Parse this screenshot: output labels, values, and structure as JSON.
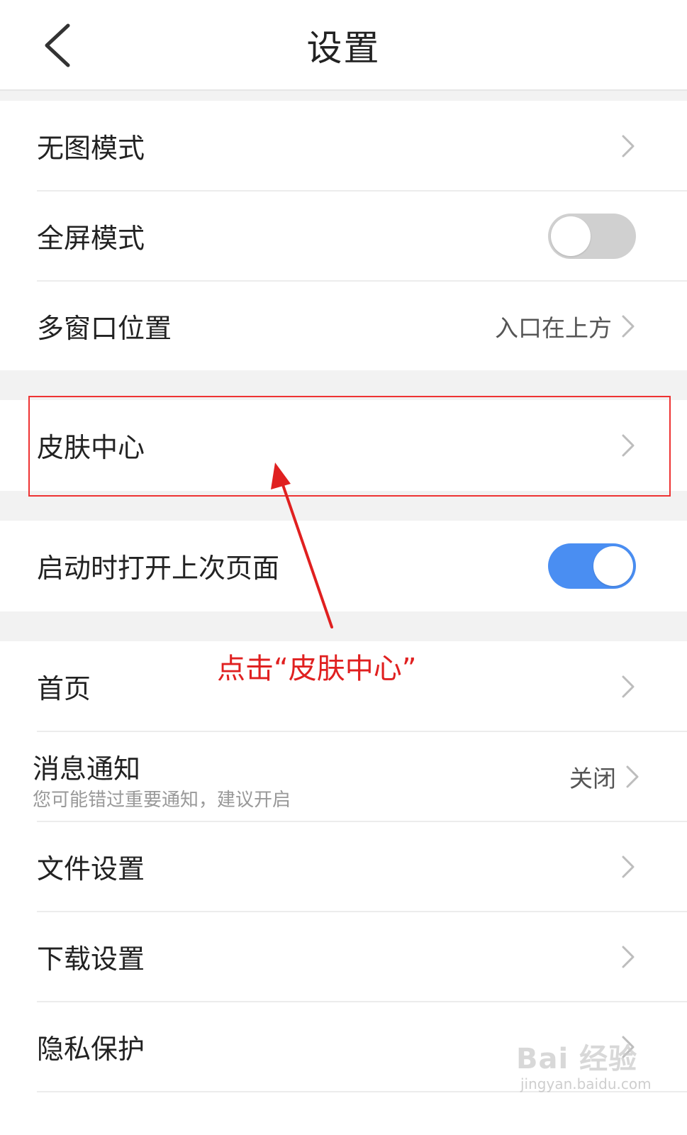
{
  "header": {
    "title": "设置"
  },
  "rows": {
    "no_image": {
      "label": "无图模式"
    },
    "fullscreen": {
      "label": "全屏模式",
      "enabled": false
    },
    "multi_window": {
      "label": "多窗口位置",
      "value": "入口在上方"
    },
    "skin_center": {
      "label": "皮肤中心"
    },
    "restore_last": {
      "label": "启动时打开上次页面",
      "enabled": true
    },
    "homepage": {
      "label": "首页"
    },
    "notification": {
      "label": "消息通知",
      "sublabel": "您可能错过重要通知，建议开启",
      "value": "关闭"
    },
    "file_settings": {
      "label": "文件设置"
    },
    "download_settings": {
      "label": "下载设置"
    },
    "privacy": {
      "label": "隐私保护"
    }
  },
  "annotation": {
    "text": "点击“皮肤中心”"
  },
  "watermark": {
    "logo": "Bai 经验",
    "url": "jingyan.baidu.com"
  },
  "colors": {
    "accent": "#4a8ef2",
    "annotation": "#e02020",
    "toggle_off": "#d0d0d0"
  },
  "icons": {
    "back": "chevron-left-icon",
    "chevron": "chevron-right-icon"
  }
}
